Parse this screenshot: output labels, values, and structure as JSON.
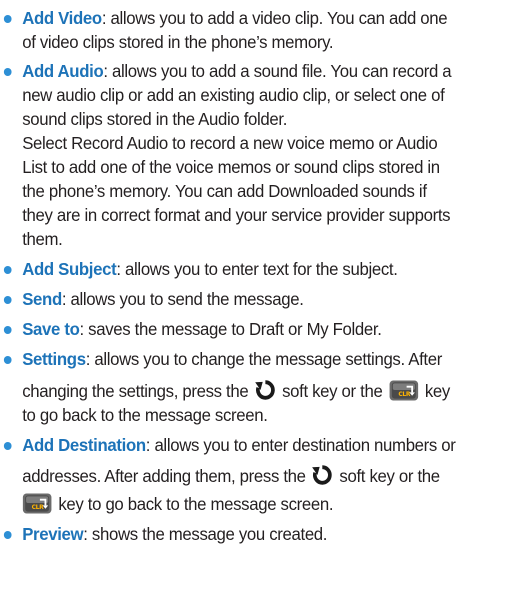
{
  "items": [
    {
      "term": "Add Video",
      "line1": ": allows you to add a video clip. You can add one",
      "line2": "of video clips stored in the phone’s memory."
    },
    {
      "term": "Add Audio",
      "line1": ": allows you to add a sound file. You can record a",
      "line2": "new audio clip or add an existing audio clip, or select one of",
      "line3": "sound clips stored in the Audio folder.",
      "line4": "Select Record Audio to record a new voice memo or Audio",
      "line5": "List to add one of the voice memos or sound clips stored in",
      "line6": "the phone’s memory. You can add Downloaded sounds if",
      "line7": "they are in correct format and your service provider supports",
      "line8": "them."
    },
    {
      "term": "Add Subject",
      "line1": ": allows you to enter text for the subject."
    },
    {
      "term": "Send",
      "line1": ": allows you to send the message."
    },
    {
      "term": "Save to",
      "line1": ": saves the message to Draft or My Folder."
    },
    {
      "term": "Settings",
      "line1": ": allows you to change the message settings. After",
      "line2a": "changing the settings, press the",
      "line2b": "soft key or the",
      "line2c": "key",
      "line3": "to go back to the message screen."
    },
    {
      "term": "Add Destination",
      "line1": ": allows you to enter destination numbers or",
      "line2a": "addresses. After adding them, press the",
      "line2b": "soft key or the",
      "line3b": "key to go back to the message screen."
    },
    {
      "term": "Preview",
      "line1": ": shows the message you created."
    }
  ],
  "colors": {
    "term": "#1d73b8",
    "bullet": "#2d8fd5",
    "text": "#231f20"
  },
  "icons": {
    "back": "back-arrow-icon",
    "clr": "clr-key-icon",
    "clr_label": "CLR"
  }
}
